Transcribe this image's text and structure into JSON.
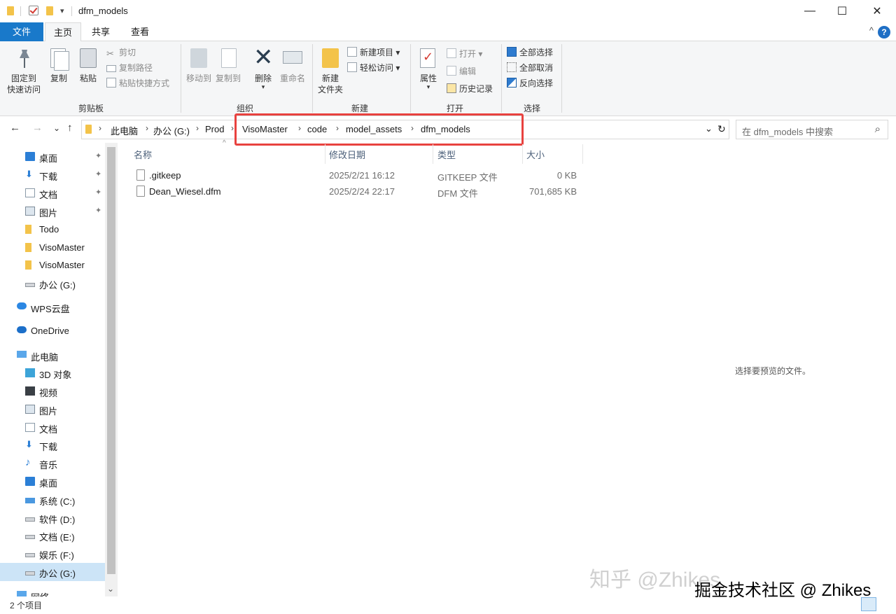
{
  "window": {
    "title": "dfm_models",
    "minimize_glyph": "—",
    "maximize_glyph": "☐",
    "close_glyph": "✕"
  },
  "qat": {
    "dropdown_glyph": "▾"
  },
  "tabs": {
    "file": "文件",
    "home": "主页",
    "share": "共享",
    "view": "查看",
    "collapse_glyph": "^",
    "help": "?"
  },
  "ribbon": {
    "clipboard": {
      "pin_line1": "固定到",
      "pin_line2": "快速访问",
      "copy": "复制",
      "paste": "粘贴",
      "cut": "剪切",
      "copy_path": "复制路径",
      "paste_shortcut": "粘贴快捷方式",
      "group": "剪贴板"
    },
    "organize": {
      "move_to": "移动到",
      "copy_to": "复制到",
      "delete": "删除",
      "rename": "重命名",
      "group": "组织"
    },
    "new": {
      "new_folder_line1": "新建",
      "new_folder_line2": "文件夹",
      "new_item": "新建项目",
      "easy_access": "轻松访问",
      "group": "新建"
    },
    "open": {
      "properties": "属性",
      "open": "打开",
      "edit": "编辑",
      "history": "历史记录",
      "group": "打开"
    },
    "select": {
      "select_all": "全部选择",
      "select_none": "全部取消",
      "invert": "反向选择",
      "group": "选择"
    }
  },
  "address": {
    "back": "←",
    "forward": "→",
    "recent": "⌄",
    "up": "↑",
    "crumbs": [
      "此电脑",
      "办公 (G:)",
      "Prod",
      "VisoMaster",
      "code",
      "model_assets",
      "dfm_models"
    ],
    "separator": "›",
    "dropdown": "⌄",
    "refresh": "↻",
    "search_placeholder": "在 dfm_models 中搜索",
    "search_icon": "⌕"
  },
  "nav": {
    "items": [
      {
        "label": "桌面",
        "icon": "desktop-icon",
        "pinned": true
      },
      {
        "label": "下载",
        "icon": "download-icon",
        "pinned": true
      },
      {
        "label": "文档",
        "icon": "documents-icon",
        "pinned": true
      },
      {
        "label": "图片",
        "icon": "pictures-icon",
        "pinned": true
      },
      {
        "label": "Todo",
        "icon": "folder-icon"
      },
      {
        "label": "VisoMaster",
        "icon": "folder-icon"
      },
      {
        "label": "VisoMaster",
        "icon": "folder-icon"
      },
      {
        "label": "办公 (G:)",
        "icon": "drive-icon"
      },
      {
        "label": "WPS云盘",
        "icon": "cloud-icon"
      },
      {
        "label": "OneDrive",
        "icon": "onedrive-icon"
      },
      {
        "label": "此电脑",
        "icon": "this-pc-icon"
      },
      {
        "label": "3D 对象",
        "icon": "3d-objects-icon"
      },
      {
        "label": "视频",
        "icon": "videos-icon"
      },
      {
        "label": "图片",
        "icon": "pictures-icon"
      },
      {
        "label": "文档",
        "icon": "documents-icon"
      },
      {
        "label": "下载",
        "icon": "download-icon"
      },
      {
        "label": "音乐",
        "icon": "music-icon"
      },
      {
        "label": "桌面",
        "icon": "desktop-icon"
      },
      {
        "label": "系统 (C:)",
        "icon": "system-drive-icon"
      },
      {
        "label": "软件 (D:)",
        "icon": "drive-icon"
      },
      {
        "label": "文档 (E:)",
        "icon": "drive-icon"
      },
      {
        "label": "娱乐 (F:)",
        "icon": "drive-icon"
      },
      {
        "label": "办公 (G:)",
        "icon": "drive-icon",
        "selected": true
      },
      {
        "label": "网络",
        "icon": "network-icon"
      }
    ],
    "pin_glyph": "📌"
  },
  "files": {
    "columns": {
      "name": "名称",
      "modified": "修改日期",
      "type": "类型",
      "size": "大小"
    },
    "sort_glyph": "^",
    "rows": [
      {
        "name": ".gitkeep",
        "modified": "2025/2/21 16:12",
        "type": "GITKEEP 文件",
        "size": "0 KB"
      },
      {
        "name": "Dean_Wiesel.dfm",
        "modified": "2025/2/24 22:17",
        "type": "DFM 文件",
        "size": "701,685 KB"
      }
    ]
  },
  "preview": {
    "message": "选择要预览的文件。"
  },
  "status": {
    "count": "2 个项目"
  },
  "watermark": {
    "text": "掘金技术社区 @ Zhikes",
    "ghost": "知乎 @Zhikes"
  },
  "colors": {
    "accent": "#1979ca",
    "highlight_box": "#e8423f",
    "selected": "#cce4f7"
  }
}
